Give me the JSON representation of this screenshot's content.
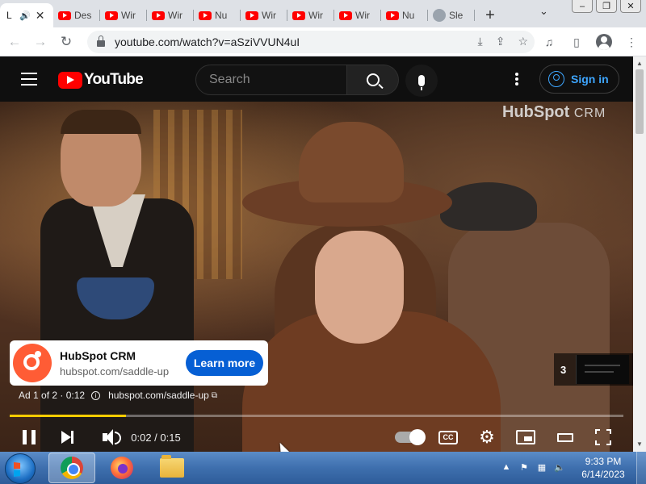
{
  "browser": {
    "tabs": [
      {
        "title": "L",
        "favicon": "speaker-icon",
        "active": true
      },
      {
        "title": "Des",
        "favicon": "youtube-icon"
      },
      {
        "title": "Wir",
        "favicon": "youtube-icon"
      },
      {
        "title": "Wir",
        "favicon": "youtube-icon"
      },
      {
        "title": "Nu",
        "favicon": "youtube-icon"
      },
      {
        "title": "Wir",
        "favicon": "youtube-icon"
      },
      {
        "title": "Wir",
        "favicon": "youtube-icon"
      },
      {
        "title": "Wir",
        "favicon": "youtube-icon"
      },
      {
        "title": "Nu",
        "favicon": "youtube-icon"
      },
      {
        "title": "Sle",
        "favicon": "cat-icon"
      }
    ],
    "new_tab": "+",
    "url": "youtube.com/watch?v=aSziVVUN4uI"
  },
  "youtube": {
    "logo_text": "YouTube",
    "search_placeholder": "Search",
    "sign_in": "Sign in"
  },
  "video": {
    "watermark": "HubSpot",
    "watermark_suffix": "CRM",
    "ad_title": "HubSpot CRM",
    "ad_url": "hubspot.com/saddle-up",
    "learn_more": "Learn more",
    "ad_counter": "Ad 1 of 2 · 0:12",
    "ad_link": "hubspot.com/saddle-up",
    "skip_number": "3",
    "time_display": "0:02 / 0:15",
    "progress_fraction": 0.19,
    "cc_label": "CC",
    "accent_color": "#ffcc00"
  },
  "taskbar": {
    "time": "9:33 PM",
    "date": "6/14/2023"
  }
}
